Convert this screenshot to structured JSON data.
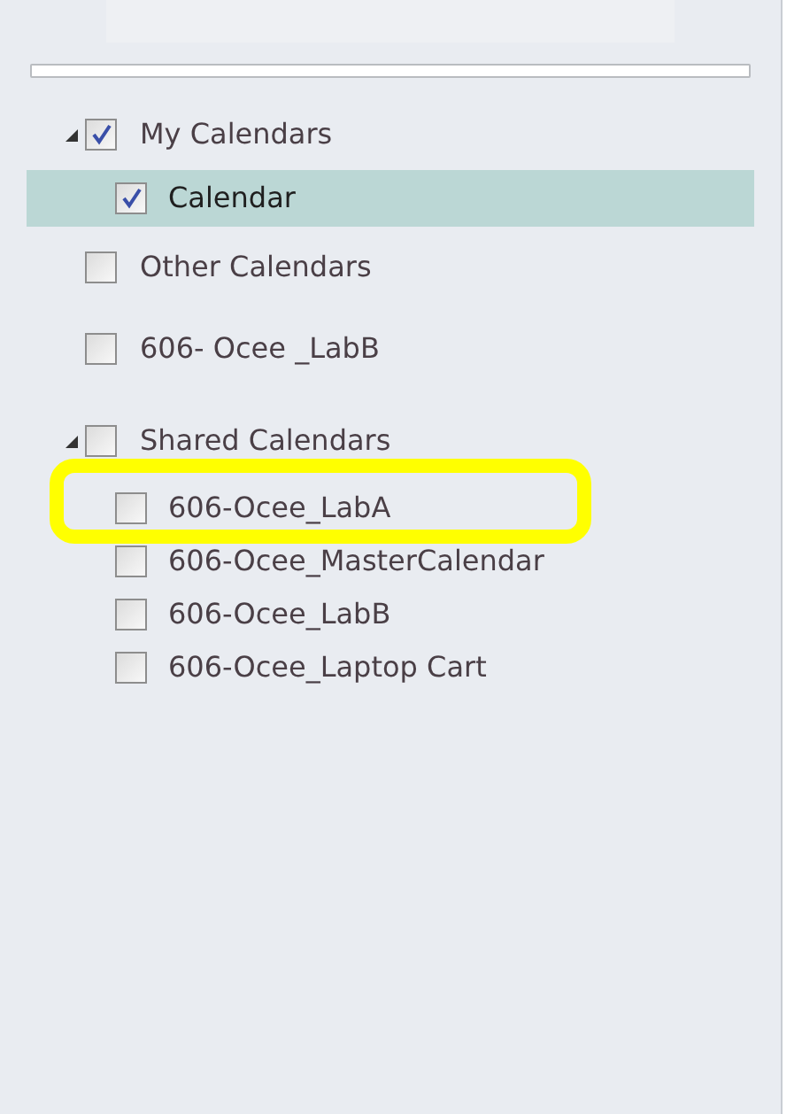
{
  "calendar_groups": [
    {
      "label": "My Calendars",
      "checked": true,
      "expanded": true,
      "children": [
        {
          "label": "Calendar",
          "checked": true,
          "selected": true
        }
      ]
    },
    {
      "label": "Other Calendars",
      "checked": false
    },
    {
      "label": "606- Ocee _LabB",
      "checked": false
    },
    {
      "label": "Shared Calendars",
      "checked": false,
      "expanded": true,
      "children": [
        {
          "label": "606-Ocee_LabA",
          "checked": false,
          "selected": false
        },
        {
          "label": "606-Ocee_MasterCalendar",
          "checked": false,
          "selected": false
        },
        {
          "label": "606-Ocee_LabB",
          "checked": false,
          "selected": false
        },
        {
          "label": "606-Ocee_Laptop Cart",
          "checked": false,
          "selected": false
        }
      ]
    }
  ]
}
